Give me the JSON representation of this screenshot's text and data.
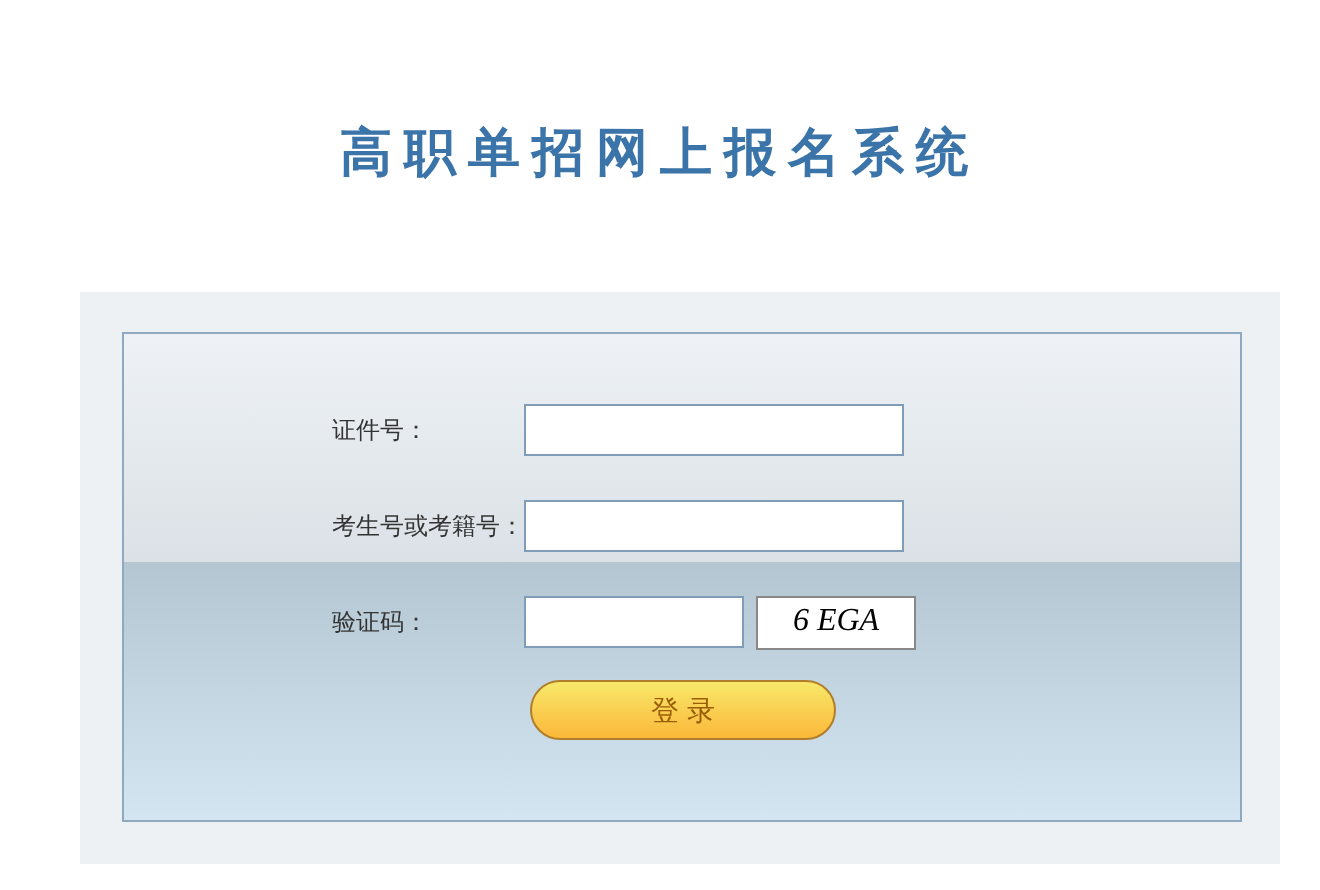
{
  "title": "高职单招网上报名系统",
  "fields": [
    {
      "label": "证件号：",
      "kind": "text"
    },
    {
      "label": "考生号或考籍号：",
      "kind": "text"
    },
    {
      "label": "验证码：",
      "kind": "captcha",
      "captcha": "6 EGA"
    }
  ],
  "login_button": "登 录"
}
